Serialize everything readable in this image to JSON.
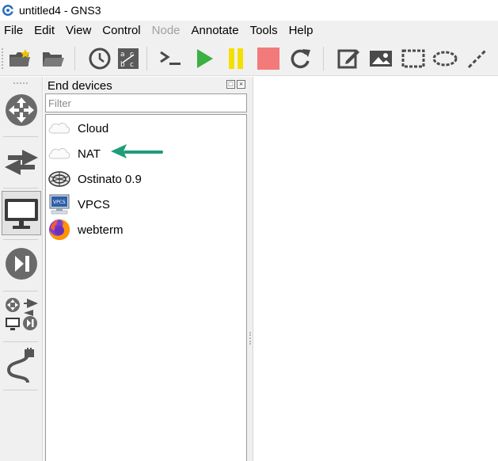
{
  "window": {
    "title": "untitled4 - GNS3",
    "icon": "gns3-logo-icon"
  },
  "menu": {
    "items": [
      {
        "label": "File",
        "enabled": true
      },
      {
        "label": "Edit",
        "enabled": true
      },
      {
        "label": "View",
        "enabled": true
      },
      {
        "label": "Control",
        "enabled": true
      },
      {
        "label": "Node",
        "enabled": false
      },
      {
        "label": "Annotate",
        "enabled": true
      },
      {
        "label": "Tools",
        "enabled": true
      },
      {
        "label": "Help",
        "enabled": true
      }
    ]
  },
  "toolbar": {
    "buttons": [
      {
        "name": "new-project",
        "icon": "folder-new-icon"
      },
      {
        "name": "open-project",
        "icon": "folder-open-icon"
      },
      {
        "name": "snapshot",
        "icon": "clock-icon"
      },
      {
        "name": "show-interface-labels",
        "icon": "abc-labels-icon"
      },
      {
        "name": "console-all",
        "icon": "terminal-icon"
      },
      {
        "name": "start-all",
        "icon": "play-icon"
      },
      {
        "name": "suspend-all",
        "icon": "pause-icon"
      },
      {
        "name": "stop-all",
        "icon": "stop-icon"
      },
      {
        "name": "reload-all",
        "icon": "reload-icon"
      },
      {
        "name": "add-note",
        "icon": "edit-note-icon"
      },
      {
        "name": "insert-picture",
        "icon": "picture-icon"
      },
      {
        "name": "draw-rectangle",
        "icon": "rectangle-icon"
      },
      {
        "name": "draw-ellipse",
        "icon": "ellipse-icon"
      },
      {
        "name": "draw-line",
        "icon": "line-icon"
      }
    ],
    "colors": {
      "play": "#3cb043",
      "pause": "#f4e000",
      "stop": "#f37a7a",
      "icon": "#4a4a4a"
    }
  },
  "dock": {
    "buttons": [
      {
        "name": "routers",
        "icon": "router-icon",
        "active": false
      },
      {
        "name": "switches",
        "icon": "switch-icon",
        "active": false
      },
      {
        "name": "end-devices",
        "icon": "monitor-icon",
        "active": true
      },
      {
        "name": "security-devices",
        "icon": "security-device-icon",
        "active": false
      },
      {
        "name": "all-devices",
        "icon": "all-devices-icon",
        "active": false
      },
      {
        "name": "add-link",
        "icon": "cable-icon",
        "active": false
      }
    ]
  },
  "devices_panel": {
    "title": "End devices",
    "filter_placeholder": "Filter",
    "filter_value": "",
    "items": [
      {
        "label": "Cloud",
        "icon": "cloud-icon"
      },
      {
        "label": "NAT",
        "icon": "cloud-icon"
      },
      {
        "label": "Ostinato 0.9",
        "icon": "ostinato-icon"
      },
      {
        "label": "VPCS",
        "icon": "vpcs-computer-icon"
      },
      {
        "label": "webterm",
        "icon": "firefox-icon"
      }
    ]
  },
  "annotation": {
    "icon": "arrow-left-icon",
    "color": "#1e9e78"
  }
}
